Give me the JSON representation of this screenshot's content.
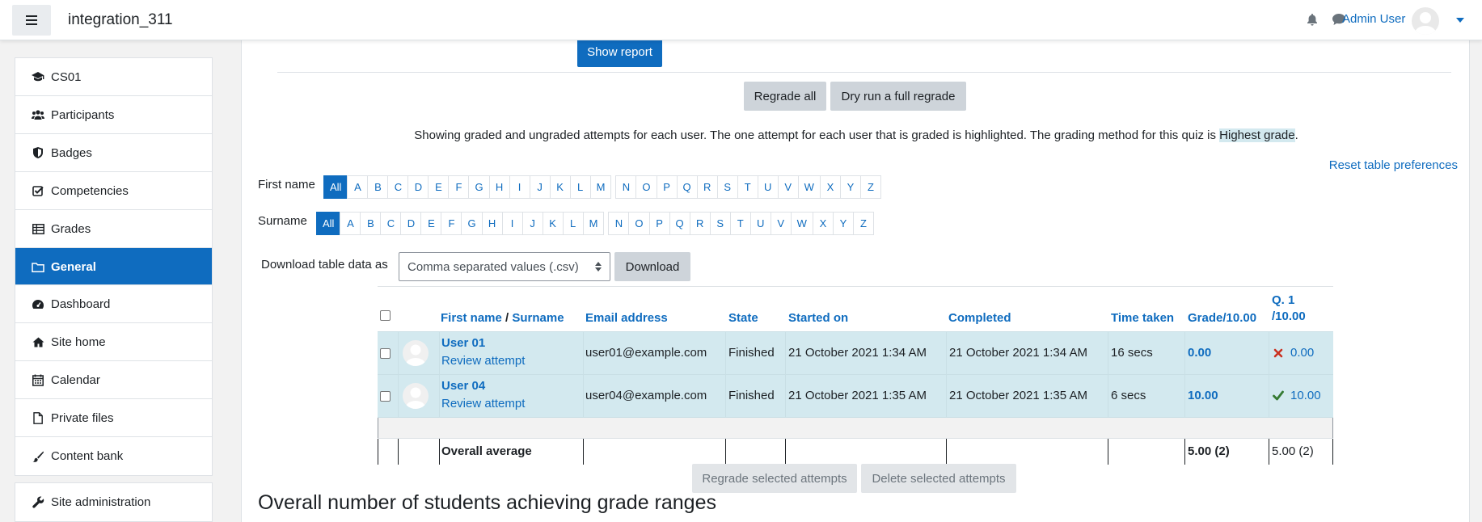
{
  "navbar": {
    "site_name": "integration_311",
    "user_name": "Admin User"
  },
  "drawer": {
    "group1": [
      {
        "icon": "graduation-cap-icon",
        "label": "CS01"
      },
      {
        "icon": "users-icon",
        "label": "Participants"
      },
      {
        "icon": "shield-icon",
        "label": "Badges"
      },
      {
        "icon": "checkbox-icon",
        "label": "Competencies"
      },
      {
        "icon": "table-icon",
        "label": "Grades"
      }
    ],
    "active": {
      "icon": "folder-icon",
      "label": "General"
    },
    "group2": [
      {
        "icon": "dashboard-icon",
        "label": "Dashboard"
      },
      {
        "icon": "home-icon",
        "label": "Site home"
      },
      {
        "icon": "calendar-icon",
        "label": "Calendar"
      },
      {
        "icon": "file-icon",
        "label": "Private files"
      },
      {
        "icon": "paintbrush-icon",
        "label": "Content bank"
      }
    ],
    "group3": [
      {
        "icon": "wrench-icon",
        "label": "Site administration"
      }
    ]
  },
  "main": {
    "show_report": "Show report",
    "regrade_all": "Regrade all",
    "dry_run": "Dry run a full regrade",
    "info_prefix": "Showing graded and ungraded attempts for each user. The one attempt for each user that is graded is highlighted. The grading method for this quiz is ",
    "info_method": "Highest grade",
    "info_suffix": ".",
    "reset_prefs": "Reset table preferences",
    "first_name_label": "First name",
    "surname_label": "Surname",
    "initials": [
      "All",
      "A",
      "B",
      "C",
      "D",
      "E",
      "F",
      "G",
      "H",
      "I",
      "J",
      "K",
      "L",
      "M",
      "N",
      "O",
      "P",
      "Q",
      "R",
      "S",
      "T",
      "U",
      "V",
      "W",
      "X",
      "Y",
      "Z"
    ],
    "download_label": "Download table data as",
    "download_format": "Comma separated values (.csv)",
    "download_button": "Download",
    "regrade_selected": "Regrade selected attempts",
    "delete_selected": "Delete selected attempts",
    "section_title": "Overall number of students achieving grade ranges"
  },
  "table": {
    "headers": {
      "first_name": "First name",
      "sep": " / ",
      "surname": "Surname",
      "email": "Email address",
      "state": "State",
      "started": "Started on",
      "completed": "Completed",
      "time": "Time taken",
      "grade": "Grade/10.00",
      "q1_line1": "Q. 1",
      "q1_line2": "/10.00"
    },
    "rows": [
      {
        "name": "User 01",
        "review": "Review attempt",
        "email": "user01@example.com",
        "state": "Finished",
        "started": "21 October 2021 1:34 AM",
        "completed": "21 October 2021 1:34 AM",
        "time": "16 secs",
        "grade": "0.00",
        "q1": "0.00",
        "q1_correct": false
      },
      {
        "name": "User 04",
        "review": "Review attempt",
        "email": "user04@example.com",
        "state": "Finished",
        "started": "21 October 2021 1:35 AM",
        "completed": "21 October 2021 1:35 AM",
        "time": "6 secs",
        "grade": "10.00",
        "q1": "10.00",
        "q1_correct": true
      }
    ],
    "average": {
      "label": "Overall average",
      "grade": "5.00 (2)",
      "q1": "5.00 (2)"
    }
  },
  "colors": {
    "primary": "#0f6cbf",
    "highlight": "#d3e9ef",
    "wrong": "#ca3120",
    "right": "#357a32"
  }
}
